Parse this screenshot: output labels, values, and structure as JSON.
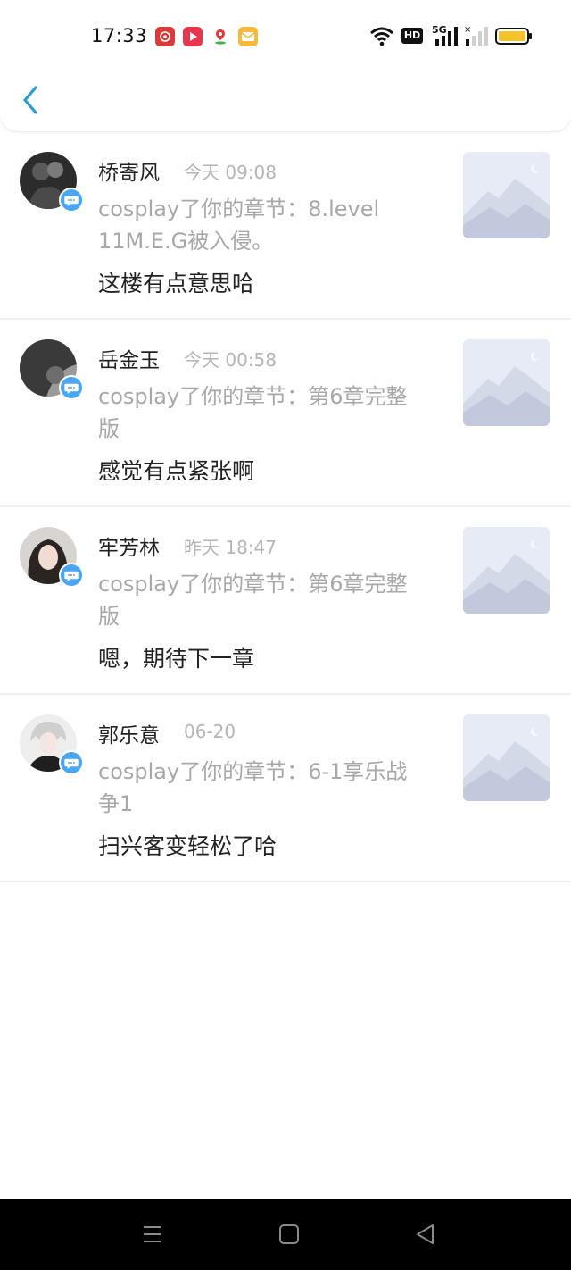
{
  "status": {
    "time": "17:33",
    "network": "5G",
    "hd_label": "HD",
    "app_icons": [
      "flower-app-icon",
      "video-app-icon",
      "map-pin-app-icon",
      "mail-app-icon"
    ],
    "colors": {
      "battery": "#f5c22b"
    }
  },
  "header": {
    "back_icon": "chevron-left-icon",
    "accent": "#2b9bd8"
  },
  "items": [
    {
      "name": "桥寄风",
      "time": "今天 09:08",
      "notice": "cosplay了你的章节：8.level 11M.E.G被入侵。",
      "reply": "这楼有点意思哈"
    },
    {
      "name": "岳金玉",
      "time": "今天 00:58",
      "notice": "cosplay了你的章节：第6章完整版",
      "reply": "感觉有点紧张啊"
    },
    {
      "name": "牢芳林",
      "time": "昨天 18:47",
      "notice": "cosplay了你的章节：第6章完整版",
      "reply": "嗯，期待下一章"
    },
    {
      "name": "郭乐意",
      "time": "06-20",
      "notice": "cosplay了你的章节：6-1享乐战争1",
      "reply": "扫兴客变轻松了哈"
    }
  ],
  "navbar": {
    "icons": [
      "menu-icon",
      "home-square-icon",
      "back-triangle-icon"
    ]
  }
}
